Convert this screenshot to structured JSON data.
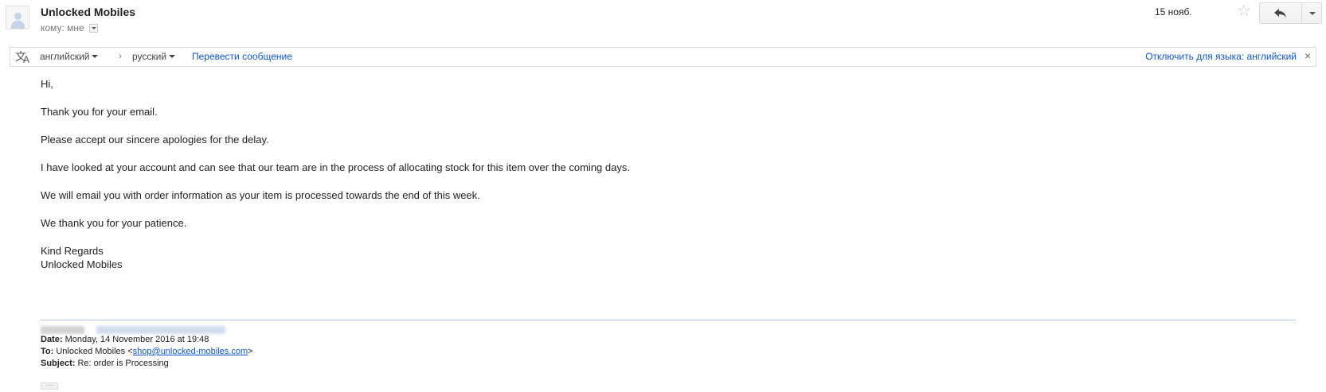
{
  "header": {
    "sender": "Unlocked Mobiles",
    "to_label": "кому: мне",
    "date": "15 нояб."
  },
  "translate_bar": {
    "source_lang": "английский",
    "arrow": "›",
    "target_lang": "русский",
    "translate_link": "Перевести сообщение",
    "disable_link": "Отключить для языка: английский",
    "close": "×"
  },
  "body": {
    "lines": [
      "Hi,",
      "Thank you for your email.",
      "Please accept our sincere apologies for the delay.",
      "I have looked at your account and can see that our team are in the process of allocating stock for this item over the coming days.",
      "We will email you with order information as your item is processed towards the end of this week.",
      "We thank you for your patience.",
      "Kind Regards",
      "Unlocked Mobiles"
    ]
  },
  "quoted": {
    "date_label": "Date:",
    "date_value": "Monday, 14 November 2016 at 19:48",
    "to_label": "To:",
    "to_name": "Unlocked Mobiles <",
    "to_email": "shop@unlocked-mobiles.com",
    "to_close": ">",
    "subject_label": "Subject:",
    "subject_value": "Re: order is Processing",
    "show_trimmed": "···"
  },
  "icons": {
    "avatar": "default-avatar-icon",
    "star": "star-icon",
    "reply": "reply-icon",
    "more": "chevron-down-icon",
    "translate": "translate-icon"
  },
  "colors": {
    "link": "#1155cc",
    "star": "#c6c6c6",
    "divider": "#b5c4df"
  }
}
